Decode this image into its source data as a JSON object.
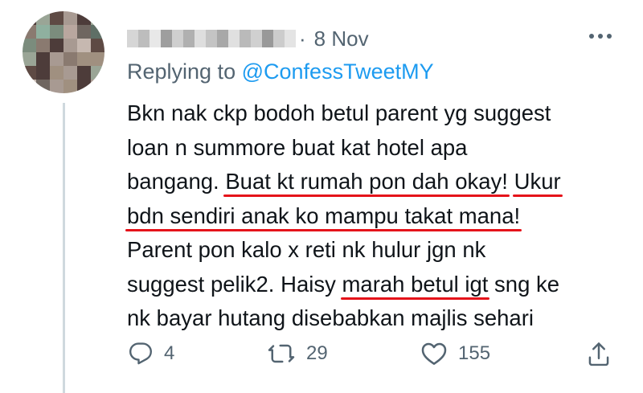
{
  "tweet": {
    "date": "8 Nov",
    "date_separator": "·",
    "replying_prefix": "Replying to",
    "replying_handle": "@ConfessTweetMY",
    "lines": [
      [
        "Bkn nak ckp bodoh betul parent yg suggest"
      ],
      [
        "loan n summore buat kat hotel apa"
      ],
      [
        "bangang. ",
        "Buat kt rumah pon dah okay!",
        " ",
        "Ukur"
      ],
      [
        "bdn sendiri anak ko mampu takat mana!"
      ],
      [
        "Parent pon kalo x reti nk hulur jgn nk"
      ],
      [
        "suggest pelik2. Haisy ",
        "marah betul igt",
        " sng ke"
      ],
      [
        "nk bayar hutang disebabkan majlis sehari"
      ]
    ],
    "counts": {
      "replies": "4",
      "retweets": "29",
      "likes": "155"
    }
  },
  "icons": {
    "reply": "reply-icon",
    "retweet": "retweet-icon",
    "like": "like-icon",
    "share": "share-icon",
    "more": "more-icon"
  },
  "colors": {
    "accent": "#1d9bf0",
    "muted": "#536471",
    "underline": "#e5131a"
  }
}
